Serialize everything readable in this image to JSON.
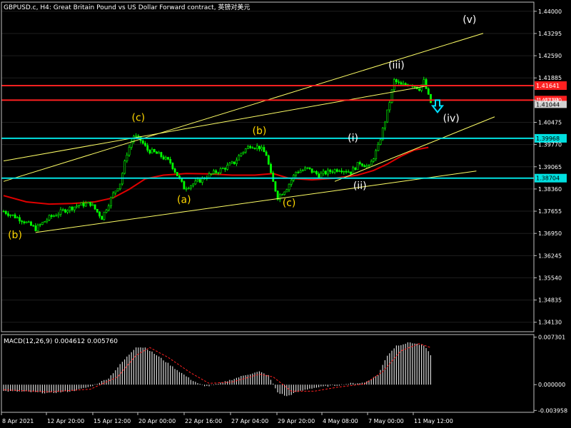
{
  "header": {
    "title": "GBPUSD.c, H4:  Great Britain Pound vs US Dollar Forward contract, 英镑对美元"
  },
  "colors": {
    "background": "#000000",
    "grid": "#1e1e1e",
    "frame": "#c0c0c0",
    "bull_candle": "#00ff00",
    "bear_candle": "#00ff00",
    "ma_line": "#e00000",
    "trendlines": "#ffff66",
    "red_levels": "#ff2020",
    "cyan_levels": "#00e0e0",
    "wave_label_yellow": "#ffd700",
    "wave_label_white": "#ffffff",
    "arrow": "#00e0ff",
    "axis_text": "#ffffff",
    "macd_hist": "#d8d8d8",
    "macd_signal": "#ff2020"
  },
  "chart_data": [
    {
      "type": "candlestick",
      "title": "GBPUSD.c, H4:  Great Britain Pound vs US Dollar Forward contract, 英镑对美元",
      "y_ticks": [
        "1.44000",
        "1.43295",
        "1.42590",
        "1.41885",
        "1.41180",
        "1.40475",
        "1.39770",
        "1.39065",
        "1.38360",
        "1.37655",
        "1.36950",
        "1.36245",
        "1.35540",
        "1.34835",
        "1.34130"
      ],
      "ylim": [
        1.3383,
        1.4429
      ],
      "x_labels": [
        "8 Apr 2021",
        "12 Apr 20:00",
        "15 Apr 12:00",
        "20 Apr 00:00",
        "22 Apr 16:00",
        "27 Apr 04:00",
        "29 Apr 20:00",
        "4 May 08:00",
        "7 May 00:00",
        "11 May 12:00"
      ],
      "close_path": [
        [
          0,
          1.3765
        ],
        [
          8,
          1.3738
        ],
        [
          14,
          1.371
        ],
        [
          20,
          1.3745
        ],
        [
          27,
          1.377
        ],
        [
          33,
          1.3785
        ],
        [
          38,
          1.379
        ],
        [
          43,
          1.3745
        ],
        [
          48,
          1.382
        ],
        [
          51,
          1.3855
        ],
        [
          54,
          1.395
        ],
        [
          57,
          1.4005
        ],
        [
          60,
          1.399
        ],
        [
          63,
          1.396
        ],
        [
          68,
          1.3945
        ],
        [
          73,
          1.392
        ],
        [
          76,
          1.388
        ],
        [
          79,
          1.384
        ],
        [
          84,
          1.3855
        ],
        [
          90,
          1.388
        ],
        [
          96,
          1.39
        ],
        [
          101,
          1.392
        ],
        [
          104,
          1.395
        ],
        [
          108,
          1.3975
        ],
        [
          112,
          1.3968
        ],
        [
          115,
          1.3945
        ],
        [
          117,
          1.388
        ],
        [
          120,
          1.381
        ],
        [
          124,
          1.384
        ],
        [
          128,
          1.389
        ],
        [
          133,
          1.39
        ],
        [
          138,
          1.388
        ],
        [
          142,
          1.389
        ],
        [
          147,
          1.39
        ],
        [
          152,
          1.389
        ],
        [
          156,
          1.392
        ],
        [
          160,
          1.3905
        ],
        [
          164,
          1.397
        ],
        [
          168,
          1.408
        ],
        [
          171,
          1.418
        ],
        [
          174,
          1.4165
        ],
        [
          178,
          1.417
        ],
        [
          182,
          1.4155
        ],
        [
          184,
          1.4178
        ],
        [
          186,
          1.413
        ],
        [
          187,
          1.411
        ]
      ],
      "ma_line": [
        [
          0,
          1.3815
        ],
        [
          10,
          1.3795
        ],
        [
          20,
          1.3788
        ],
        [
          30,
          1.379
        ],
        [
          40,
          1.3795
        ],
        [
          48,
          1.3808
        ],
        [
          55,
          1.3835
        ],
        [
          62,
          1.3868
        ],
        [
          70,
          1.388
        ],
        [
          80,
          1.3885
        ],
        [
          90,
          1.3884
        ],
        [
          100,
          1.388
        ],
        [
          110,
          1.388
        ],
        [
          118,
          1.3885
        ],
        [
          125,
          1.387
        ],
        [
          135,
          1.3865
        ],
        [
          145,
          1.387
        ],
        [
          155,
          1.388
        ],
        [
          162,
          1.3895
        ],
        [
          168,
          1.3915
        ],
        [
          174,
          1.394
        ],
        [
          180,
          1.396
        ],
        [
          186,
          1.3968
        ]
      ],
      "horizontal_levels": [
        {
          "price": 1.41641,
          "label": "1.41641",
          "color": "red"
        },
        {
          "price": 1.41181,
          "label": "1.41181",
          "color": "red"
        },
        {
          "price": 1.39968,
          "label": "1.39968",
          "color": "cyan"
        },
        {
          "price": 1.38704,
          "label": "1.38704",
          "color": "cyan"
        }
      ],
      "current_price_label": "1.41044",
      "trendlines": [
        {
          "from": [
            0,
            1.386
          ],
          "to": [
            210,
            1.433
          ]
        },
        {
          "from": [
            0,
            1.3925
          ],
          "to": [
            187,
            1.4165
          ]
        },
        {
          "from": [
            14,
            1.3698
          ],
          "to": [
            207,
            1.3893
          ]
        },
        {
          "from": [
            145,
            1.386
          ],
          "to": [
            215,
            1.4065
          ]
        }
      ],
      "wave_labels": [
        {
          "text": "(b)",
          "x": 5,
          "price": 1.368,
          "color": "yellow"
        },
        {
          "text": "(c)",
          "x": 59,
          "price": 1.4052,
          "color": "yellow"
        },
        {
          "text": "(a)",
          "x": 79,
          "price": 1.3792,
          "color": "yellow"
        },
        {
          "text": "(b)",
          "x": 112,
          "price": 1.401,
          "color": "yellow"
        },
        {
          "text": "(c)",
          "x": 125,
          "price": 1.3781,
          "color": "yellow"
        },
        {
          "text": "(i)",
          "x": 153,
          "price": 1.3987,
          "color": "white"
        },
        {
          "text": "(ii)",
          "x": 156,
          "price": 1.3836,
          "color": "white"
        },
        {
          "text": "(iii)",
          "x": 172,
          "price": 1.4218,
          "color": "white"
        },
        {
          "text": "(iv)",
          "x": 196,
          "price": 1.405,
          "color": "white"
        },
        {
          "text": "(v)",
          "x": 204,
          "price": 1.4363,
          "color": "white"
        }
      ],
      "arrow": {
        "x": 190,
        "price": 1.41,
        "direction": "down"
      }
    },
    {
      "type": "bar",
      "title": "MACD(12,26,9) 0.004612 0.005760",
      "y_ticks": [
        "0.007301",
        "0.000000",
        "-0.003958"
      ],
      "ylim": [
        -0.00425,
        0.0077
      ],
      "histogram_path": [
        [
          0,
          -0.001
        ],
        [
          10,
          -0.0011
        ],
        [
          20,
          -0.0013
        ],
        [
          30,
          -0.001
        ],
        [
          38,
          -0.0003
        ],
        [
          46,
          0.001
        ],
        [
          52,
          0.0035
        ],
        [
          58,
          0.0058
        ],
        [
          62,
          0.0057
        ],
        [
          68,
          0.0043
        ],
        [
          75,
          0.0025
        ],
        [
          82,
          0.0008
        ],
        [
          88,
          -0.0003
        ],
        [
          94,
          0.0001
        ],
        [
          100,
          0.0008
        ],
        [
          106,
          0.0015
        ],
        [
          112,
          0.002
        ],
        [
          116,
          0.0014
        ],
        [
          120,
          -0.0012
        ],
        [
          124,
          -0.0018
        ],
        [
          128,
          -0.0012
        ],
        [
          134,
          -0.0006
        ],
        [
          140,
          -0.0003
        ],
        [
          146,
          -0.0001
        ],
        [
          152,
          0.0002
        ],
        [
          158,
          0.0003
        ],
        [
          164,
          0.0015
        ],
        [
          168,
          0.0045
        ],
        [
          172,
          0.006
        ],
        [
          178,
          0.0065
        ],
        [
          184,
          0.006
        ],
        [
          187,
          0.0046
        ]
      ],
      "signal_path": [
        [
          0,
          -0.0008
        ],
        [
          20,
          -0.0011
        ],
        [
          38,
          -0.0007
        ],
        [
          50,
          0.0012
        ],
        [
          58,
          0.0045
        ],
        [
          64,
          0.0057
        ],
        [
          72,
          0.0042
        ],
        [
          82,
          0.0018
        ],
        [
          90,
          0.0002
        ],
        [
          100,
          0.0004
        ],
        [
          112,
          0.0016
        ],
        [
          118,
          0.0012
        ],
        [
          126,
          -0.001
        ],
        [
          136,
          -0.001
        ],
        [
          146,
          -0.0004
        ],
        [
          158,
          0.0001
        ],
        [
          166,
          0.002
        ],
        [
          174,
          0.0052
        ],
        [
          182,
          0.0063
        ],
        [
          187,
          0.0057
        ]
      ]
    }
  ]
}
